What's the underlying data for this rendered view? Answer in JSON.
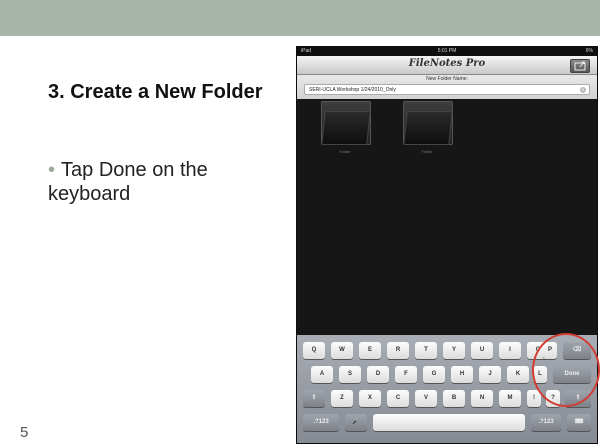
{
  "slide": {
    "title": "3. Create a New Folder",
    "bullet": "Tap Done on the keyboard",
    "page_number": "5"
  },
  "ipad": {
    "status_left": "iPad",
    "status_time": "5:01 PM",
    "status_right": "6%",
    "app_title": "FileNotes Pro",
    "new_folder_label": "New Folder Name:",
    "new_folder_value": "SERI-UCLA Workshop 1/24/2010_Only",
    "folders": [
      {
        "label": "Folder"
      },
      {
        "label": "Folder"
      }
    ]
  },
  "keyboard": {
    "row1": [
      "Q",
      "W",
      "E",
      "R",
      "T",
      "Y",
      "U",
      "I",
      "O",
      "P"
    ],
    "row2": [
      "A",
      "S",
      "D",
      "F",
      "G",
      "H",
      "J",
      "K",
      "L"
    ],
    "row3": [
      "Z",
      "X",
      "C",
      "V",
      "B",
      "N",
      "M",
      "!",
      "?"
    ],
    "done": "Done",
    "numbers": ".?123",
    "backspace": "⌫",
    "shift": "⇧",
    "mic": "🎤",
    "hide": "⌨"
  },
  "colors": {
    "top_band": "#a7b5a9",
    "highlight_circle": "#d23c32"
  }
}
